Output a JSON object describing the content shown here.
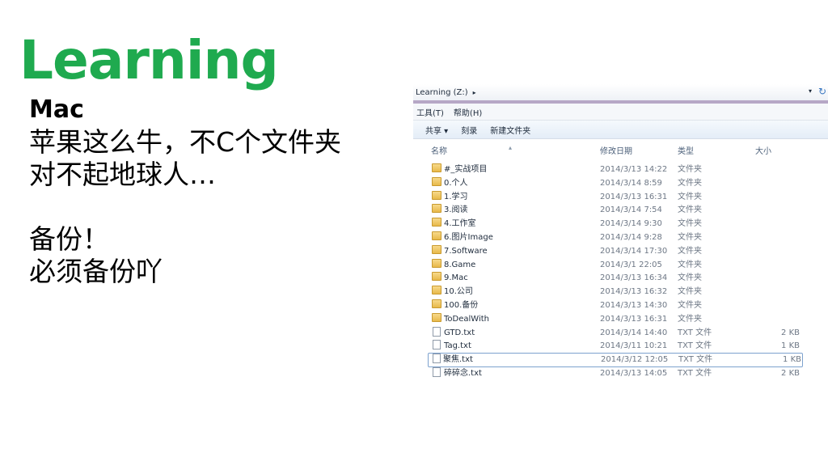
{
  "slide": {
    "title": "Learning",
    "subtitle": "Mac",
    "lines": [
      "苹果这么牛，不C个文件夹",
      "对不起地球人…"
    ],
    "lines2": [
      "备份！",
      "必须备份吖"
    ]
  },
  "explorer": {
    "address": "Learning (Z:)",
    "menu": [
      "工具(T)",
      "帮助(H)"
    ],
    "toolbar": [
      "共享 ▾",
      "刻录",
      "新建文件夹"
    ],
    "columns": {
      "name": "名称",
      "date": "修改日期",
      "type": "类型",
      "size": "大小"
    },
    "rows": [
      {
        "name": "#_实战项目",
        "date": "2014/3/13 14:22",
        "type": "文件夹",
        "size": "",
        "kind": "folder"
      },
      {
        "name": "0.个人",
        "date": "2014/3/14 8:59",
        "type": "文件夹",
        "size": "",
        "kind": "folder"
      },
      {
        "name": "1.学习",
        "date": "2014/3/13 16:31",
        "type": "文件夹",
        "size": "",
        "kind": "folder"
      },
      {
        "name": "3.阅读",
        "date": "2014/3/14 7:54",
        "type": "文件夹",
        "size": "",
        "kind": "folder"
      },
      {
        "name": "4.工作室",
        "date": "2014/3/14 9:30",
        "type": "文件夹",
        "size": "",
        "kind": "folder"
      },
      {
        "name": "6.图片Image",
        "date": "2014/3/14 9:28",
        "type": "文件夹",
        "size": "",
        "kind": "folder"
      },
      {
        "name": "7.Software",
        "date": "2014/3/14 17:30",
        "type": "文件夹",
        "size": "",
        "kind": "folder"
      },
      {
        "name": "8.Game",
        "date": "2014/3/1 22:05",
        "type": "文件夹",
        "size": "",
        "kind": "folder"
      },
      {
        "name": "9.Mac",
        "date": "2014/3/13 16:34",
        "type": "文件夹",
        "size": "",
        "kind": "folder"
      },
      {
        "name": "10.公司",
        "date": "2014/3/13 16:32",
        "type": "文件夹",
        "size": "",
        "kind": "folder"
      },
      {
        "name": "100.备份",
        "date": "2014/3/13 14:30",
        "type": "文件夹",
        "size": "",
        "kind": "folder"
      },
      {
        "name": "ToDealWith",
        "date": "2014/3/13 16:31",
        "type": "文件夹",
        "size": "",
        "kind": "folder"
      },
      {
        "name": "GTD.txt",
        "date": "2014/3/14 14:40",
        "type": "TXT 文件",
        "size": "2 KB",
        "kind": "file"
      },
      {
        "name": "Tag.txt",
        "date": "2014/3/11 10:21",
        "type": "TXT 文件",
        "size": "1 KB",
        "kind": "file"
      },
      {
        "name": "聚焦.txt",
        "date": "2014/3/12 12:05",
        "type": "TXT 文件",
        "size": "1 KB",
        "kind": "file",
        "selected": true
      },
      {
        "name": "碎碎念.txt",
        "date": "2014/3/13 14:05",
        "type": "TXT 文件",
        "size": "2 KB",
        "kind": "file"
      }
    ]
  }
}
